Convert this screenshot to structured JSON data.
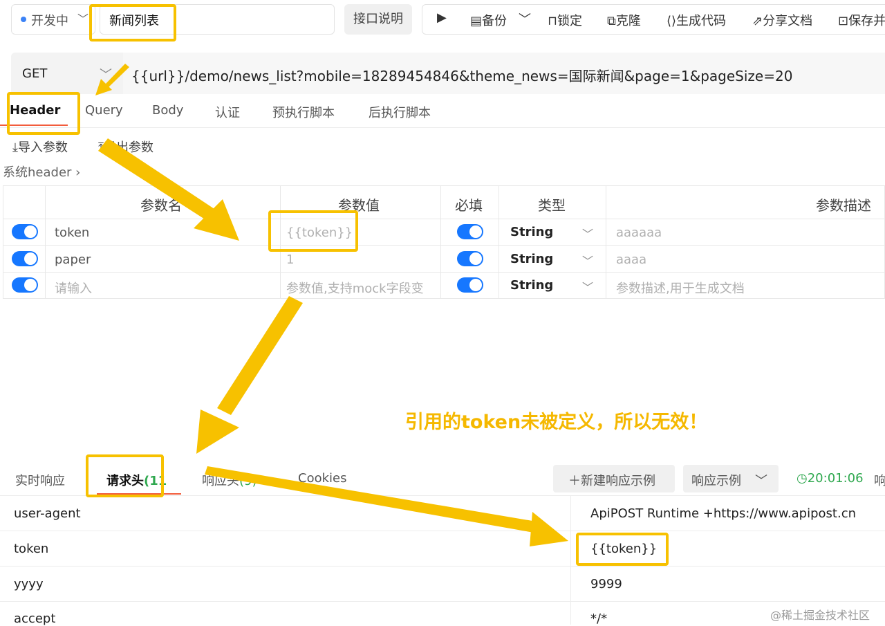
{
  "topbar": {
    "status": "开发中",
    "api_name": "新闻列表",
    "doc_button": "接口说明",
    "toolbar": {
      "backup": "备份",
      "lock": "锁定",
      "clone": "克隆",
      "gen_code": "生成代码",
      "share_doc": "分享文档",
      "save": "保存并"
    }
  },
  "request": {
    "method": "GET",
    "url": "{{url}}/demo/news_list?mobile=18289454846&theme_news=国际新闻&page=1&pageSize=20"
  },
  "tabs": [
    "Header",
    "Query",
    "Body",
    "认证",
    "预执行脚本",
    "后执行脚本"
  ],
  "params_actions": {
    "import": "导入参数",
    "export": "导出参数",
    "system_header": "系统header"
  },
  "params_table": {
    "headers": {
      "name": "参数名",
      "value": "参数值",
      "required": "必填",
      "type": "类型",
      "desc": "参数描述"
    },
    "rows": [
      {
        "enabled": true,
        "name": "token",
        "value": "{{token}}",
        "required": true,
        "type": "String",
        "desc": "aaaaaa"
      },
      {
        "enabled": true,
        "name": "paper",
        "value": "1",
        "required": true,
        "type": "String",
        "desc": "aaaa"
      },
      {
        "enabled": true,
        "name": "请输入",
        "value": "参数值,支持mock字段变",
        "required": true,
        "type": "String",
        "desc": "参数描述,用于生成文档"
      }
    ]
  },
  "annotation": "引用的token未被定义，所以无效！",
  "response": {
    "tabs": {
      "realtime": "实时响应",
      "req_headers": "请求头",
      "req_headers_count": "(11",
      "resp_headers": "响应头",
      "resp_headers_count": "(9)",
      "cookies": "Cookies"
    },
    "new_example": "新建响应示例",
    "example": "响应示例",
    "time": "20:01:06",
    "trailing": "响",
    "rows": [
      {
        "key": "user-agent",
        "value": "ApiPOST Runtime +https://www.apipost.cn"
      },
      {
        "key": "token",
        "value": "{{token}}"
      },
      {
        "key": "yyyy",
        "value": "9999"
      },
      {
        "key": "accept",
        "value": "*/*"
      }
    ]
  },
  "watermark": "@稀土掘金技术社区",
  "colors": {
    "highlight": "#f7c100",
    "accent": "#f25c3c",
    "toggle": "#1677ff",
    "success": "#2fa84f"
  }
}
